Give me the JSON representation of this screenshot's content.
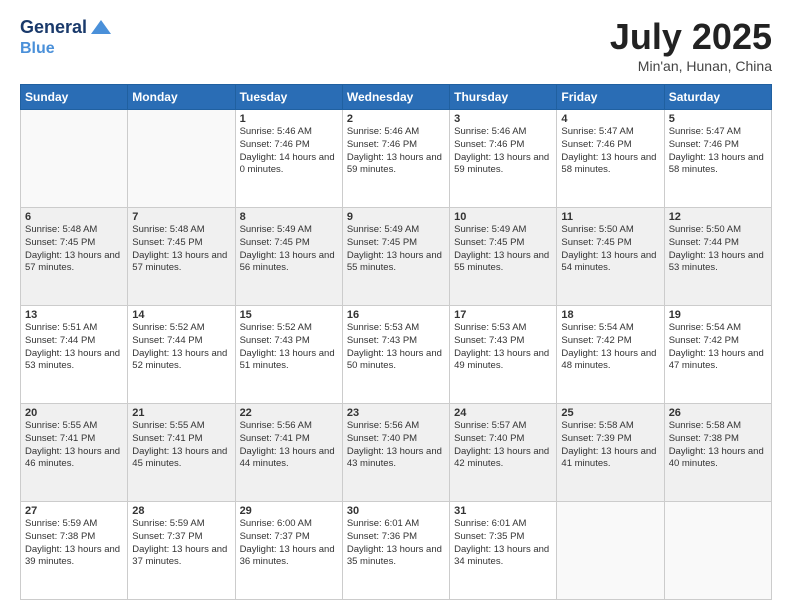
{
  "header": {
    "logo_line1": "General",
    "logo_line2": "Blue",
    "title": "July 2025",
    "subtitle": "Min'an, Hunan, China"
  },
  "days_of_week": [
    "Sunday",
    "Monday",
    "Tuesday",
    "Wednesday",
    "Thursday",
    "Friday",
    "Saturday"
  ],
  "weeks": [
    [
      {
        "day": "",
        "info": ""
      },
      {
        "day": "",
        "info": ""
      },
      {
        "day": "1",
        "info": "Sunrise: 5:46 AM\nSunset: 7:46 PM\nDaylight: 14 hours and 0 minutes."
      },
      {
        "day": "2",
        "info": "Sunrise: 5:46 AM\nSunset: 7:46 PM\nDaylight: 13 hours and 59 minutes."
      },
      {
        "day": "3",
        "info": "Sunrise: 5:46 AM\nSunset: 7:46 PM\nDaylight: 13 hours and 59 minutes."
      },
      {
        "day": "4",
        "info": "Sunrise: 5:47 AM\nSunset: 7:46 PM\nDaylight: 13 hours and 58 minutes."
      },
      {
        "day": "5",
        "info": "Sunrise: 5:47 AM\nSunset: 7:46 PM\nDaylight: 13 hours and 58 minutes."
      }
    ],
    [
      {
        "day": "6",
        "info": "Sunrise: 5:48 AM\nSunset: 7:45 PM\nDaylight: 13 hours and 57 minutes."
      },
      {
        "day": "7",
        "info": "Sunrise: 5:48 AM\nSunset: 7:45 PM\nDaylight: 13 hours and 57 minutes."
      },
      {
        "day": "8",
        "info": "Sunrise: 5:49 AM\nSunset: 7:45 PM\nDaylight: 13 hours and 56 minutes."
      },
      {
        "day": "9",
        "info": "Sunrise: 5:49 AM\nSunset: 7:45 PM\nDaylight: 13 hours and 55 minutes."
      },
      {
        "day": "10",
        "info": "Sunrise: 5:49 AM\nSunset: 7:45 PM\nDaylight: 13 hours and 55 minutes."
      },
      {
        "day": "11",
        "info": "Sunrise: 5:50 AM\nSunset: 7:45 PM\nDaylight: 13 hours and 54 minutes."
      },
      {
        "day": "12",
        "info": "Sunrise: 5:50 AM\nSunset: 7:44 PM\nDaylight: 13 hours and 53 minutes."
      }
    ],
    [
      {
        "day": "13",
        "info": "Sunrise: 5:51 AM\nSunset: 7:44 PM\nDaylight: 13 hours and 53 minutes."
      },
      {
        "day": "14",
        "info": "Sunrise: 5:52 AM\nSunset: 7:44 PM\nDaylight: 13 hours and 52 minutes."
      },
      {
        "day": "15",
        "info": "Sunrise: 5:52 AM\nSunset: 7:43 PM\nDaylight: 13 hours and 51 minutes."
      },
      {
        "day": "16",
        "info": "Sunrise: 5:53 AM\nSunset: 7:43 PM\nDaylight: 13 hours and 50 minutes."
      },
      {
        "day": "17",
        "info": "Sunrise: 5:53 AM\nSunset: 7:43 PM\nDaylight: 13 hours and 49 minutes."
      },
      {
        "day": "18",
        "info": "Sunrise: 5:54 AM\nSunset: 7:42 PM\nDaylight: 13 hours and 48 minutes."
      },
      {
        "day": "19",
        "info": "Sunrise: 5:54 AM\nSunset: 7:42 PM\nDaylight: 13 hours and 47 minutes."
      }
    ],
    [
      {
        "day": "20",
        "info": "Sunrise: 5:55 AM\nSunset: 7:41 PM\nDaylight: 13 hours and 46 minutes."
      },
      {
        "day": "21",
        "info": "Sunrise: 5:55 AM\nSunset: 7:41 PM\nDaylight: 13 hours and 45 minutes."
      },
      {
        "day": "22",
        "info": "Sunrise: 5:56 AM\nSunset: 7:41 PM\nDaylight: 13 hours and 44 minutes."
      },
      {
        "day": "23",
        "info": "Sunrise: 5:56 AM\nSunset: 7:40 PM\nDaylight: 13 hours and 43 minutes."
      },
      {
        "day": "24",
        "info": "Sunrise: 5:57 AM\nSunset: 7:40 PM\nDaylight: 13 hours and 42 minutes."
      },
      {
        "day": "25",
        "info": "Sunrise: 5:58 AM\nSunset: 7:39 PM\nDaylight: 13 hours and 41 minutes."
      },
      {
        "day": "26",
        "info": "Sunrise: 5:58 AM\nSunset: 7:38 PM\nDaylight: 13 hours and 40 minutes."
      }
    ],
    [
      {
        "day": "27",
        "info": "Sunrise: 5:59 AM\nSunset: 7:38 PM\nDaylight: 13 hours and 39 minutes."
      },
      {
        "day": "28",
        "info": "Sunrise: 5:59 AM\nSunset: 7:37 PM\nDaylight: 13 hours and 37 minutes."
      },
      {
        "day": "29",
        "info": "Sunrise: 6:00 AM\nSunset: 7:37 PM\nDaylight: 13 hours and 36 minutes."
      },
      {
        "day": "30",
        "info": "Sunrise: 6:01 AM\nSunset: 7:36 PM\nDaylight: 13 hours and 35 minutes."
      },
      {
        "day": "31",
        "info": "Sunrise: 6:01 AM\nSunset: 7:35 PM\nDaylight: 13 hours and 34 minutes."
      },
      {
        "day": "",
        "info": ""
      },
      {
        "day": "",
        "info": ""
      }
    ]
  ]
}
